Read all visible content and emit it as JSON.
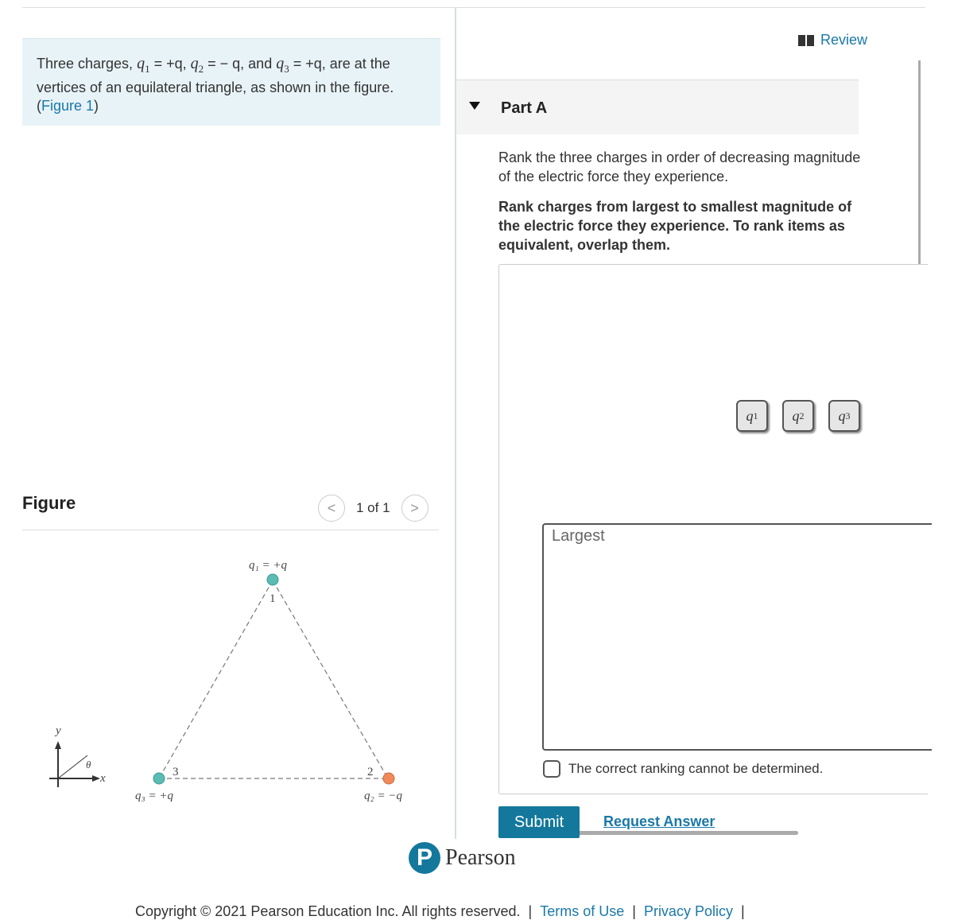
{
  "intro": {
    "text_before": "Three charges, ",
    "q1": "q",
    "q1_sub": "1",
    "q1_val": " = +q",
    "sep1": ", ",
    "q2": "q",
    "q2_sub": "2",
    "q2_val": " = − q",
    "sep2": ", and ",
    "q3": "q",
    "q3_sub": "3",
    "q3_val": " = +q",
    "text_after": ", are at the vertices of an equilateral triangle, as shown in the figure.(",
    "figure_link": "Figure 1",
    ")": ")"
  },
  "figure": {
    "title": "Figure",
    "pager": "1 of 1",
    "prev": "<",
    "next": ">",
    "labels": {
      "q1": "q₁ = +q",
      "q2": "q₂ = −q",
      "q3": "q₃ = +q",
      "v1": "1",
      "v2": "2",
      "v3": "3",
      "axis_x": "x",
      "axis_y": "y",
      "theta": "θ"
    },
    "colors": {
      "positive": "#5bbcb4",
      "negative": "#f08a5a"
    }
  },
  "review": {
    "label": "Review",
    "icon": "book-icon"
  },
  "partA": {
    "label": "Part A",
    "question": "Rank the three charges in order of decreasing magnitude of the electric force they experience.",
    "instructions": "Rank charges from largest to smallest magnitude of the electric force they experience. To rank items as equivalent, overlap them.",
    "chips": [
      {
        "base": "q",
        "sub": "1"
      },
      {
        "base": "q",
        "sub": "2"
      },
      {
        "base": "q",
        "sub": "3"
      }
    ],
    "target_label": "Largest",
    "checkbox_label": "The correct ranking cannot be determined.",
    "submit": "Submit",
    "request_answer": "Request Answer"
  },
  "footer": {
    "brand": "Pearson",
    "copyright": "Copyright © 2021 Pearson Education Inc. All rights reserved.",
    "terms": "Terms of Use",
    "privacy": "Privacy Policy"
  },
  "colors": {
    "accent": "#13789c",
    "link": "#1a78a8",
    "intro_bg": "#e8f3f7"
  }
}
